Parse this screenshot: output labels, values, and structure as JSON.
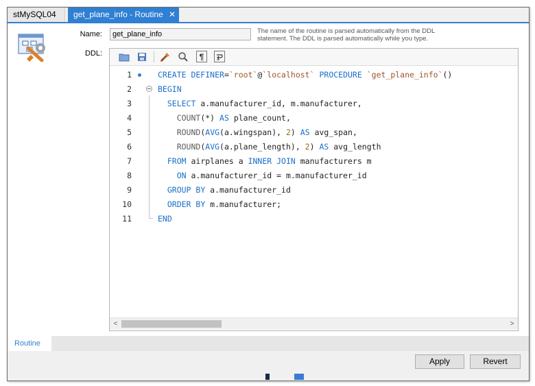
{
  "tabs": [
    {
      "label": "stMySQL04",
      "active": false
    },
    {
      "label": "get_plane_info - Routine",
      "active": true,
      "close_icon": "close-icon"
    }
  ],
  "form": {
    "name_label": "Name:",
    "name_value": "get_plane_info",
    "hint": "The name of the routine is parsed automatically from the DDL statement. The DDL is parsed automatically while you type.",
    "ddl_label": "DDL:"
  },
  "toolbar": {
    "icons": [
      "open-folder-icon",
      "save-icon",
      "beautify-brush-icon",
      "find-magnifier-icon",
      "invisible-chars-pilcrow-icon",
      "word-wrap-icon"
    ]
  },
  "code": {
    "lines": [
      {
        "n": "1",
        "tokens": [
          [
            "kw",
            "CREATE DEFINER"
          ],
          [
            "id",
            "="
          ],
          [
            "str",
            "`root`"
          ],
          [
            "id",
            "@"
          ],
          [
            "str",
            "`localhost`"
          ],
          [
            "id",
            " "
          ],
          [
            "kw",
            "PROCEDURE"
          ],
          [
            "id",
            " "
          ],
          [
            "str",
            "`get_plane_info`"
          ],
          [
            "id",
            "()"
          ]
        ]
      },
      {
        "n": "2",
        "tokens": [
          [
            "kw",
            "BEGIN"
          ]
        ]
      },
      {
        "n": "3",
        "tokens": [
          [
            "id",
            "  "
          ],
          [
            "kw",
            "SELECT"
          ],
          [
            "id",
            " a.manufacturer_id, m.manufacturer,"
          ]
        ]
      },
      {
        "n": "4",
        "tokens": [
          [
            "id",
            "    "
          ],
          [
            "fn",
            "COUNT"
          ],
          [
            "id",
            "(*) "
          ],
          [
            "kw",
            "AS"
          ],
          [
            "id",
            " plane_count,"
          ]
        ]
      },
      {
        "n": "5",
        "tokens": [
          [
            "id",
            "    "
          ],
          [
            "fn",
            "ROUND"
          ],
          [
            "id",
            "("
          ],
          [
            "kw",
            "AVG"
          ],
          [
            "id",
            "(a.wingspan), "
          ],
          [
            "num",
            "2"
          ],
          [
            "id",
            ") "
          ],
          [
            "kw",
            "AS"
          ],
          [
            "id",
            " avg_span,"
          ]
        ]
      },
      {
        "n": "6",
        "tokens": [
          [
            "id",
            "    "
          ],
          [
            "fn",
            "ROUND"
          ],
          [
            "id",
            "("
          ],
          [
            "kw",
            "AVG"
          ],
          [
            "id",
            "(a.plane_length), "
          ],
          [
            "num",
            "2"
          ],
          [
            "id",
            ") "
          ],
          [
            "kw",
            "AS"
          ],
          [
            "id",
            " avg_length"
          ]
        ]
      },
      {
        "n": "7",
        "tokens": [
          [
            "id",
            "  "
          ],
          [
            "kw",
            "FROM"
          ],
          [
            "id",
            " airplanes a "
          ],
          [
            "kw",
            "INNER JOIN"
          ],
          [
            "id",
            " manufacturers m"
          ]
        ]
      },
      {
        "n": "8",
        "tokens": [
          [
            "id",
            "    "
          ],
          [
            "kw",
            "ON"
          ],
          [
            "id",
            " a.manufacturer_id = m.manufacturer_id"
          ]
        ]
      },
      {
        "n": "9",
        "tokens": [
          [
            "id",
            "  "
          ],
          [
            "kw",
            "GROUP BY"
          ],
          [
            "id",
            " a.manufacturer_id"
          ]
        ]
      },
      {
        "n": "10",
        "tokens": [
          [
            "id",
            "  "
          ],
          [
            "kw",
            "ORDER BY"
          ],
          [
            "id",
            " m.manufacturer;"
          ]
        ]
      },
      {
        "n": "11",
        "tokens": [
          [
            "kw",
            "END"
          ]
        ]
      }
    ]
  },
  "scrollbar": {
    "left_arrow": "<",
    "right_arrow": ">"
  },
  "bottom_tabs": [
    {
      "label": "Routine",
      "active": true
    }
  ],
  "buttons": {
    "apply": "Apply",
    "revert": "Revert"
  }
}
